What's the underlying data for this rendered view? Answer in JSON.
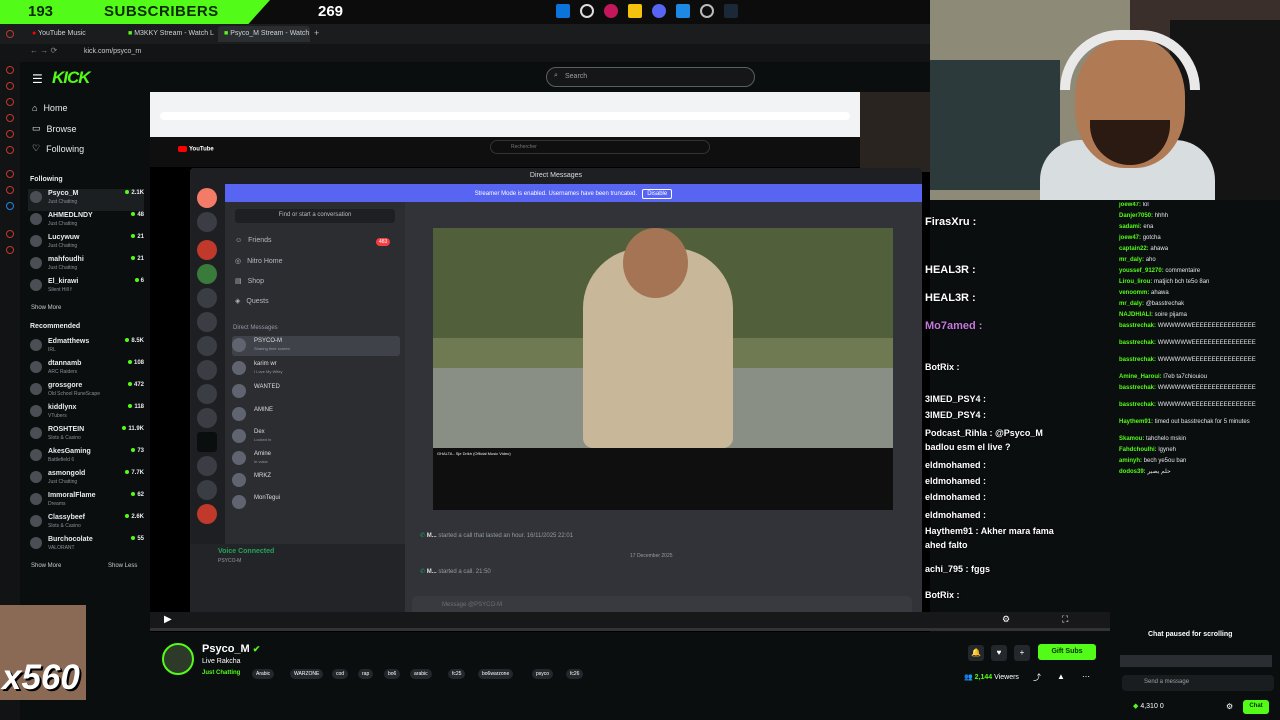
{
  "overlay": {
    "subscribers_count": "193",
    "subscribers_label": "SUBSCRIBERS",
    "goal_count": "269"
  },
  "browser": {
    "tabs": [
      "YouTube Music",
      "M3KKY Stream - Watch L",
      "Psyco_M Stream - Watch"
    ],
    "url": "kick.com/psyco_m"
  },
  "kick": {
    "logo": "KICK",
    "search_placeholder": "Search",
    "nav": [
      {
        "label": "Home",
        "icon": "home-icon"
      },
      {
        "label": "Browse",
        "icon": "compass-icon"
      },
      {
        "label": "Following",
        "icon": "heart-icon"
      }
    ],
    "following_title": "Following",
    "following": [
      {
        "name": "Psyco_M",
        "category": "Just Chatting",
        "viewers": "2.1K"
      },
      {
        "name": "AHMEDLNDY",
        "category": "Just Chatting",
        "viewers": "48"
      },
      {
        "name": "Lucywuw",
        "category": "Just Chatting",
        "viewers": "21"
      },
      {
        "name": "mahfoudhi",
        "category": "Just Chatting",
        "viewers": "21"
      },
      {
        "name": "El_kirawi",
        "category": "Silent Hill f",
        "viewers": "6"
      }
    ],
    "show_more": "Show More",
    "show_less": "Show Less",
    "recommended_title": "Recommended",
    "recommended": [
      {
        "name": "Edmatthews",
        "category": "IRL",
        "viewers": "8.5K"
      },
      {
        "name": "dtannamb",
        "category": "ARC Raiders",
        "viewers": "108"
      },
      {
        "name": "grossgore",
        "category": "Old School RuneScape",
        "viewers": "472"
      },
      {
        "name": "kiddlynx",
        "category": "VTubers",
        "viewers": "118"
      },
      {
        "name": "ROSHTEIN",
        "category": "Slots & Casino",
        "viewers": "11.9K"
      },
      {
        "name": "AkesGaming",
        "category": "Battlefield 6",
        "viewers": "73"
      },
      {
        "name": "asmongold",
        "category": "Just Chatting",
        "viewers": "7.7K"
      },
      {
        "name": "ImmoralFlame",
        "category": "Dreams",
        "viewers": "62"
      },
      {
        "name": "Classybeef",
        "category": "Slots & Casino",
        "viewers": "2.6K"
      },
      {
        "name": "Burchocolate",
        "category": "VALORANT",
        "viewers": "55"
      }
    ]
  },
  "stream_content": {
    "discord_title": "Direct Messages",
    "streamer_banner": "Streamer Mode is enabled. Usernames have been truncated.",
    "disable_label": "Disable",
    "find_conversation": "Find or start a conversation",
    "dm_nav": [
      {
        "label": "Friends",
        "icon": "friends-icon"
      },
      {
        "label": "Nitro Home",
        "icon": "nitro-icon"
      },
      {
        "label": "Shop",
        "icon": "shop-icon"
      },
      {
        "label": "Quests",
        "icon": "quests-icon"
      }
    ],
    "friends_badge": "483",
    "dm_header": "Direct Messages",
    "dms": [
      {
        "name": "PSYCO-M",
        "status": "Sharing their screen"
      },
      {
        "name": "karim wr",
        "status": "I Love My Wifey"
      },
      {
        "name": "WANTED",
        "status": ""
      },
      {
        "name": "AMINE",
        "status": ""
      },
      {
        "name": "Dex",
        "status": "Locked In"
      },
      {
        "name": "Amine",
        "status": "In voice"
      },
      {
        "name": "MRKZ",
        "status": ""
      },
      {
        "name": "MonTegui",
        "status": ""
      }
    ],
    "voice_connected": "Voice Connected",
    "voice_sub": "PSYCO-M",
    "youtube_search": "Rechercher",
    "video_title": "GHALTA - Sje Drikh (Official Music Video)",
    "call_message_1": "started a call that lasted an hour.",
    "call_date_1": "16/11/2025 22:01",
    "date_divider": "17 December 2025",
    "call_message_2": "started a call.",
    "call_time_2": "21:50",
    "message_placeholder": "Message @PSYCO-M"
  },
  "chat_overlay": [
    "FirasXru :",
    "HEAL3R :",
    "HEAL3R :",
    "Mo7amed :",
    "BotRix :",
    "3IMED_PSY4 :",
    "3IMED_PSY4 :",
    "Podcast_Rihla : @Psyco_M",
    "badlou esm el live ?",
    "eldmohamed :",
    "eldmohamed :",
    "eldmohamed :",
    "eldmohamed :",
    "Haythem91 : Akher mara fama",
    "ahed falto",
    "achi_795 : fggs",
    "BotRix :"
  ],
  "chat": {
    "messages": [
      {
        "user": "joew47",
        "text": "lol"
      },
      {
        "user": "Danjer7050",
        "text": "hhhh"
      },
      {
        "user": "sadami",
        "text": "ena"
      },
      {
        "user": "joew47",
        "text": "gotcha"
      },
      {
        "user": "captain22",
        "text": "ahawa"
      },
      {
        "user": "mr_daly",
        "text": "aho"
      },
      {
        "user": "youssef_91270",
        "text": "commentaire"
      },
      {
        "user": "Lirou_lirou",
        "text": "matjich bch te5o 8an"
      },
      {
        "user": "venoomm",
        "text": "ahawa"
      },
      {
        "user": "mr_daly",
        "text": "@basstrechak"
      },
      {
        "user": "NAJDHIALI",
        "text": "soire pijama"
      },
      {
        "user": "basstrechak",
        "text": "WWWWWWEEEEEEEEEEEEEEEE"
      },
      {
        "user": "basstrechak",
        "text": "WWWWWWEEEEEEEEEEEEEEEE"
      },
      {
        "user": "basstrechak",
        "text": "WWWWWWEEEEEEEEEEEEEEEE"
      },
      {
        "user": "Amine_Haroui",
        "text": "l7eb ta7chiouiou"
      },
      {
        "user": "basstrechak",
        "text": "WWWWWWEEEEEEEEEEEEEEEE"
      },
      {
        "user": "basstrechak",
        "text": "WWWWWWEEEEEEEEEEEEEEEE"
      },
      {
        "user": "Haythem91",
        "text": "timed out basstrechak for 5 minutes"
      },
      {
        "user": "Skamou",
        "text": "tahchelo mskin"
      },
      {
        "user": "Fahdchoulhi",
        "text": "lgyneh"
      },
      {
        "user": "aminyh",
        "text": "bech ye5ou ban"
      },
      {
        "user": "dodos39",
        "text": "حلم يصير"
      }
    ],
    "paused": "Chat paused for scrolling",
    "send_placeholder": "Send a message",
    "points": "4,310",
    "points_zero": "0",
    "chat_button": "Chat"
  },
  "stream_info": {
    "channel": "Psyco_M",
    "title": "Live Rakcha",
    "category": "Just Chatting",
    "tags": [
      "Arabic",
      "WARZONE",
      "cod",
      "rap",
      "bo6",
      "arabic",
      "fc25",
      "bo6warzone",
      "psyco",
      "fc26"
    ],
    "gift_subs": "Gift Subs",
    "viewers": "2,144",
    "viewers_label": "Viewers"
  },
  "emote_overlay": {
    "multiplier": "x560"
  }
}
